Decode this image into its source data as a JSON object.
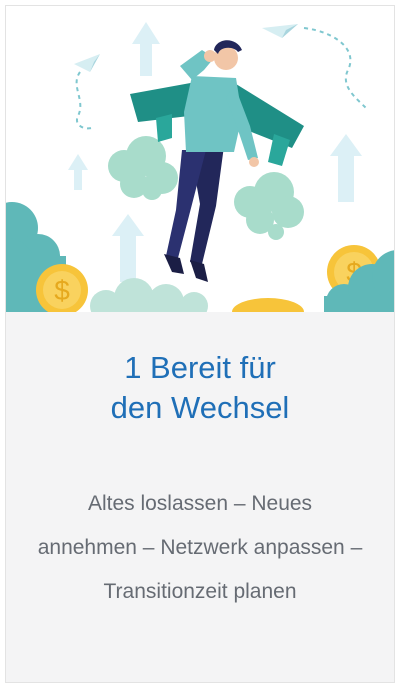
{
  "card": {
    "title_line1": "1 Bereit für",
    "title_line2": "den Wechsel",
    "description": "Altes loslassen – Neues annehmen – Netzwerk anpassen – Transitionzeit planen"
  },
  "illustration": {
    "subject": "man-with-jetpack-wings",
    "icons": [
      "paper-plane-icon",
      "arrow-up-icon",
      "dollar-coin-icon",
      "cloud-icon"
    ]
  },
  "colors": {
    "title": "#1f6fb7",
    "body_text": "#666b73",
    "panel_bg": "#f4f4f5",
    "teal": "#1f8f86",
    "mint": "#a8dccb"
  }
}
